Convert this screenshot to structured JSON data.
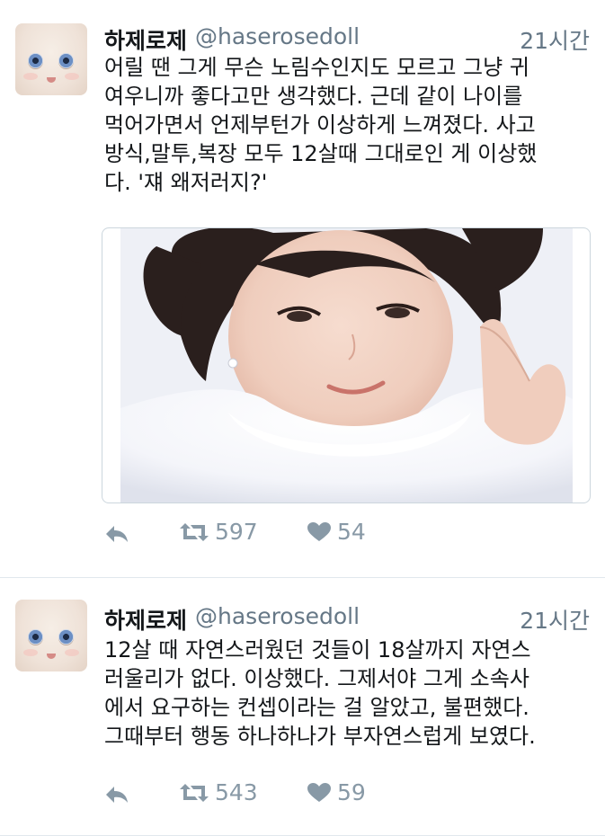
{
  "tweets": [
    {
      "display_name": "하제로제",
      "handle": "@haserosedoll",
      "time": "21시간",
      "text": "어릴 땐 그게 무슨 노림수인지도 모르고 그냥 귀\n여우니까 좋다고만 생각했다. 근데 같이 나이를\n먹어가면서 언제부턴가 이상하게 느껴졌다. 사고\n방식,말투,복장 모두 12살때 그대로인 게 이상했\n다. '쟤 왜저러지?'",
      "retweets": "597",
      "likes": "54",
      "has_media": true
    },
    {
      "display_name": "하제로제",
      "handle": "@haserosedoll",
      "time": "21시간",
      "text": "12살 때 자연스러웠던 것들이 18살까지 자연스\n러울리가 없다. 이상했다. 그제서야 그게 소속사\n에서 요구하는 컨셉이라는 걸 알았고, 불편했다.\n그때부터 행동 하나하나가 부자연스럽게 보였다.",
      "retweets": "543",
      "likes": "59",
      "has_media": false
    }
  ],
  "icons": {
    "reply": "reply-icon",
    "retweet": "retweet-icon",
    "like": "heart-icon"
  },
  "colors": {
    "text": "#14171a",
    "secondary": "#657786",
    "action": "#8899a6",
    "divider": "#e1e8ed"
  }
}
